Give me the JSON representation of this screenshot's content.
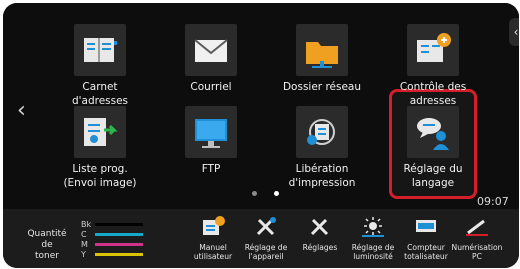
{
  "nav": {
    "prev_glyph": "‹",
    "side_tab_glyph": "‹"
  },
  "tiles": [
    {
      "label": "Carnet\nd'adresses",
      "icon": "address-book-icon"
    },
    {
      "label": "Courriel",
      "icon": "envelope-icon"
    },
    {
      "label": "Dossier réseau",
      "icon": "folder-icon"
    },
    {
      "label": "Contrôle des\nadresses",
      "icon": "address-check-icon"
    },
    {
      "label": "Liste prog.\n(Envoi image)",
      "icon": "program-list-icon"
    },
    {
      "label": "FTP",
      "icon": "monitor-icon"
    },
    {
      "label": "Libération\nd'impression",
      "icon": "print-release-icon"
    },
    {
      "label": "Réglage du\nlangage",
      "icon": "language-icon"
    }
  ],
  "status": {
    "time": "09:07",
    "page_dots": 2,
    "active_dot": 1
  },
  "toner": {
    "title": "Quantité de\ntoner",
    "colors": [
      {
        "key": "Bk",
        "color": "#000000"
      },
      {
        "key": "C",
        "color": "#16a7c9"
      },
      {
        "key": "M",
        "color": "#d0338a"
      },
      {
        "key": "Y",
        "color": "#d9c400"
      }
    ]
  },
  "bottom": [
    {
      "label": "Manuel\nutilisateur",
      "icon": "manual-icon"
    },
    {
      "label": "Réglage de\nl'appareil",
      "icon": "device-settings-icon"
    },
    {
      "label": "Réglages",
      "icon": "settings-icon"
    },
    {
      "label": "Réglage de\nluminosité",
      "icon": "brightness-icon"
    },
    {
      "label": "Compteur\ntotalisateur",
      "icon": "counter-icon"
    },
    {
      "label": "Numérisation\nPC",
      "icon": "pc-scan-icon"
    }
  ],
  "accent": {
    "selection": "#d21f2a",
    "icon_orange": "#f0a020",
    "icon_blue": "#1f8fd6"
  }
}
